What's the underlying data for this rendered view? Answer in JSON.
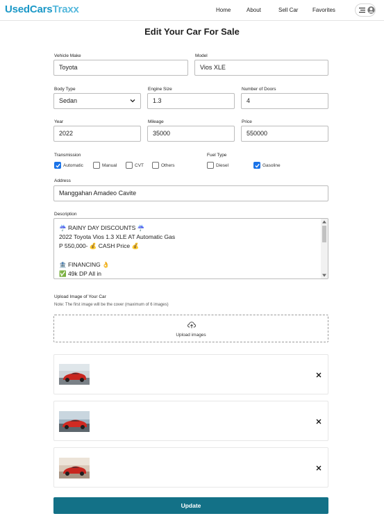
{
  "brand": {
    "name_part1": "UsedCars",
    "name_part2": "Traxx"
  },
  "nav": {
    "home": "Home",
    "about": "About",
    "sell_car": "Sell Car",
    "favorites": "Favorites"
  },
  "page_title": "Edit Your Car For Sale",
  "form": {
    "vehicle_make": {
      "label": "Vehicle Make",
      "value": "Toyota"
    },
    "model": {
      "label": "Model",
      "value": "Vios XLE"
    },
    "body_type": {
      "label": "Body Type",
      "value": "Sedan"
    },
    "engine_size": {
      "label": "Engine Size",
      "value": "1.3"
    },
    "doors": {
      "label": "Number of Doors",
      "value": "4"
    },
    "year": {
      "label": "Year",
      "value": "2022"
    },
    "mileage": {
      "label": "Mileage",
      "value": "35000"
    },
    "price": {
      "label": "Price",
      "value": "550000"
    },
    "transmission": {
      "label": "Transmission",
      "options": [
        {
          "label": "Automatic",
          "checked": true
        },
        {
          "label": "Manual",
          "checked": false
        },
        {
          "label": "CVT",
          "checked": false
        },
        {
          "label": "Others",
          "checked": false
        }
      ]
    },
    "fuel_type": {
      "label": "Fuel Type",
      "options": [
        {
          "label": "Diesel",
          "checked": false
        },
        {
          "label": "Gasoline",
          "checked": true
        }
      ]
    },
    "address": {
      "label": "Address",
      "value": "Manggahan Amadeo Cavite"
    },
    "description": {
      "label": "Description",
      "lines": [
        "☔ RAINY DAY DISCOUNTS ☔",
        "2022 Toyota Vios 1.3 XLE AT Automatic Gas",
        "P 550,000- 💰 CASH Price 💰",
        "",
        "🏦 FINANCING 👌",
        "✅ 49k DP All in"
      ]
    }
  },
  "upload": {
    "title": "Upload Image of Your Car",
    "note": "Note: The first image will be the cover (maximum of 6 images)",
    "button_label": "Upload images"
  },
  "colors": {
    "brand": "#1b98c7",
    "update_button": "#137187",
    "checkbox_checked": "#1a73e8"
  },
  "update_label": "Update"
}
